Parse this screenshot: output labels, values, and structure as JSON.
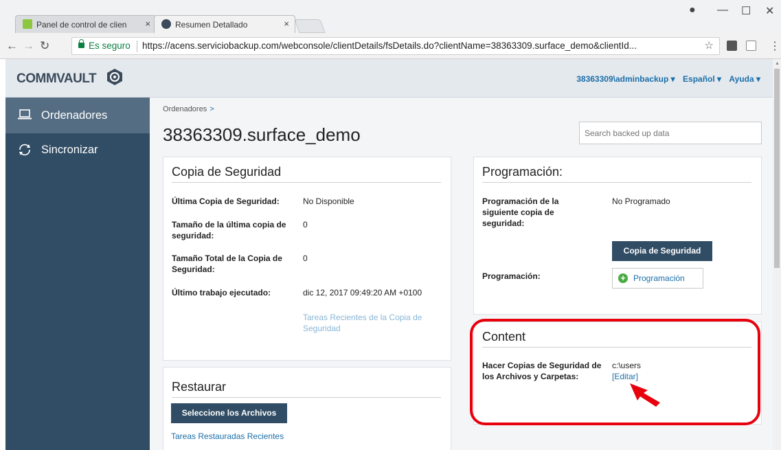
{
  "browser": {
    "tabs": [
      {
        "title": "Panel de control de clien",
        "active": false
      },
      {
        "title": "Resumen Detallado",
        "active": true
      }
    ],
    "tab_close": "×",
    "secure_label": "Es seguro",
    "url": "https://acens.serviciobackup.com/webconsole/clientDetails/fsDetails.do?clientName=38363309.surface_demo&clientId...",
    "window_controls": {
      "minimize": "—",
      "maximize": "☐",
      "close": "✕"
    }
  },
  "header": {
    "logo": "COMMVAULT",
    "user": "38363309\\adminbackup ▾",
    "language": "Español ▾",
    "help": "Ayuda ▾"
  },
  "sidebar": {
    "items": [
      {
        "label": "Ordenadores",
        "icon": "laptop-icon",
        "active": true
      },
      {
        "label": "Sincronizar",
        "icon": "sync-icon",
        "active": false
      }
    ]
  },
  "main": {
    "breadcrumb": "Ordenadores",
    "breadcrumb_chevron": ">",
    "title": "38363309.surface_demo",
    "search_placeholder": "Search backed up data"
  },
  "backup_panel": {
    "title": "Copia de Seguridad",
    "rows": [
      {
        "label": "Última Copia de Seguridad:",
        "value": "No Disponible"
      },
      {
        "label": "Tamaño de la última copia de seguridad:",
        "value": "0"
      },
      {
        "label": "Tamaño Total de la Copia de Seguridad:",
        "value": "0"
      },
      {
        "label": "Último trabajo ejecutado:",
        "value": "dic 12, 2017 09:49:20 AM +0100"
      }
    ],
    "recent_link": "Tareas Recientes de la Copia de Seguridad"
  },
  "schedule_panel": {
    "title": "Programación:",
    "next_label": "Programación de la siguiente copia de seguridad:",
    "next_value": "No Programado",
    "backup_button": "Copia de Seguridad",
    "schedule_label": "Programación:",
    "schedule_button": "Programación",
    "plus": "+"
  },
  "content_panel": {
    "title": "Content",
    "label": "Hacer Copias de Seguridad de los Archivos y Carpetas:",
    "value": "c:\\users",
    "edit_link": "[Editar]"
  },
  "restore_panel": {
    "title": "Restaurar",
    "select_button": "Seleccione los Archivos",
    "recent_link": "Tareas Restauradas Recientes"
  },
  "colors": {
    "sidebar": "#314d65",
    "sidebar_active": "#556d82",
    "link": "#1b6ea8",
    "highlight": "#e8000d",
    "secure": "#0b8043"
  }
}
